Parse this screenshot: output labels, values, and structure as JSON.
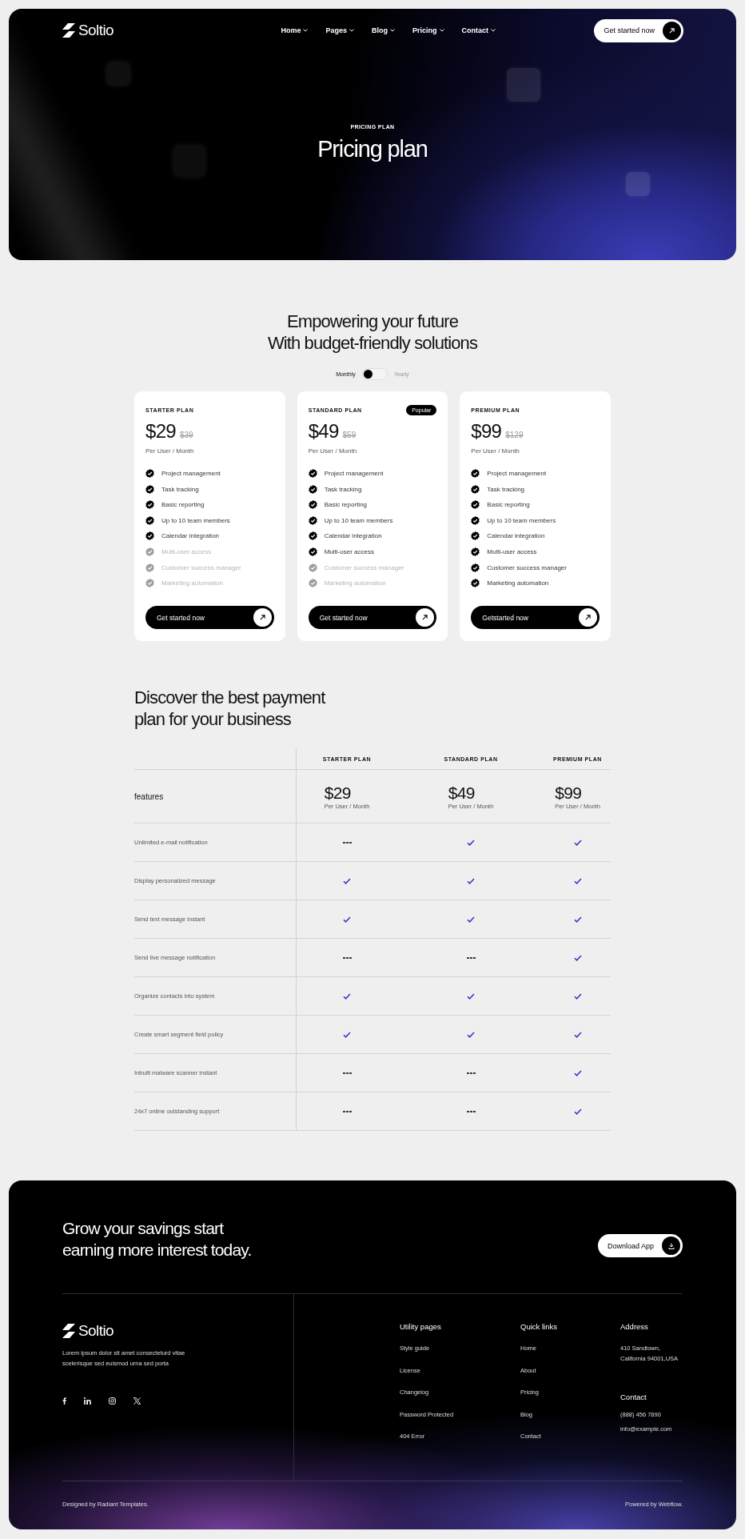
{
  "brand": "Soltio",
  "nav": [
    {
      "label": "Home"
    },
    {
      "label": "Pages"
    },
    {
      "label": "Blog"
    },
    {
      "label": "Pricing"
    },
    {
      "label": "Contact"
    }
  ],
  "nav_button": "Get started now",
  "hero": {
    "eyebrow": "PRICING PLAN",
    "title": "Pricing plan"
  },
  "pricing": {
    "heading": [
      "Empowering your future",
      "With budget-friendly solutions"
    ],
    "billing_toggle": {
      "left": "Monthly",
      "right": "Yearly",
      "yearly": false
    },
    "plans": [
      {
        "name": "STARTER PLAN",
        "price": "$29",
        "old_price": "$39",
        "period": "Per User / Month",
        "button": "Get started now",
        "features": [
          {
            "label": "Project management",
            "included": true
          },
          {
            "label": "Task tracking",
            "included": true
          },
          {
            "label": "Basic reporting",
            "included": true
          },
          {
            "label": "Up to 10 team members",
            "included": true
          },
          {
            "label": "Calendar integration",
            "included": true
          },
          {
            "label": "Multi-user access",
            "included": false
          },
          {
            "label": "Customer success manager",
            "included": false
          },
          {
            "label": "Marketing automation",
            "included": false
          }
        ]
      },
      {
        "name": "STANDARD PLAN",
        "price": "$49",
        "old_price": "$59",
        "period": "Per User / Month",
        "badge": "Popular",
        "button": "Get started now",
        "features": [
          {
            "label": "Project management",
            "included": true
          },
          {
            "label": "Task tracking",
            "included": true
          },
          {
            "label": "Basic reporting",
            "included": true
          },
          {
            "label": "Up to 10 team members",
            "included": true
          },
          {
            "label": "Calendar integration",
            "included": true
          },
          {
            "label": "Multi-user access",
            "included": true
          },
          {
            "label": "Customer success manager",
            "included": false
          },
          {
            "label": "Marketing automation",
            "included": false
          }
        ]
      },
      {
        "name": "PREMIUM PLAN",
        "price": "$99",
        "old_price": "$129",
        "period": "Per User / Month",
        "button": "Getstarted now",
        "features": [
          {
            "label": "Project management",
            "included": true
          },
          {
            "label": "Task tracking",
            "included": true
          },
          {
            "label": "Basic reporting",
            "included": true
          },
          {
            "label": "Up to 10 team members",
            "included": true
          },
          {
            "label": "Calendar integration",
            "included": true
          },
          {
            "label": "Multi-user access",
            "included": true
          },
          {
            "label": "Customer success manager",
            "included": true
          },
          {
            "label": "Marketing automation",
            "included": true
          }
        ]
      }
    ]
  },
  "comparison": {
    "heading": [
      "Discover the best payment",
      "plan for your business"
    ],
    "features_label": "features",
    "columns": [
      {
        "name": "STARTER PLAN",
        "price": "$29",
        "period": "Per User / Month"
      },
      {
        "name": "STANDARD PLAN",
        "price": "$49",
        "period": "Per User / Month"
      },
      {
        "name": "PREMIUM PLAN",
        "price": "$99",
        "period": "Per User / Month"
      }
    ],
    "rows": [
      {
        "label": "Unlimited e-mail notification",
        "included": [
          false,
          true,
          true
        ]
      },
      {
        "label": "Display personalized message",
        "included": [
          true,
          true,
          true
        ]
      },
      {
        "label": "Send text message instant",
        "included": [
          true,
          true,
          true
        ]
      },
      {
        "label": "Send live message notification",
        "included": [
          false,
          false,
          true
        ]
      },
      {
        "label": "Organize contacts into system",
        "included": [
          true,
          true,
          true
        ]
      },
      {
        "label": "Create smart segment field policy",
        "included": [
          true,
          true,
          true
        ]
      },
      {
        "label": "Inbuilt malware scanner instant",
        "included": [
          false,
          false,
          true
        ]
      },
      {
        "label": "24x7 online outstanding support",
        "included": [
          false,
          false,
          true
        ]
      }
    ]
  },
  "footer": {
    "cta": [
      "Grow your savings start",
      "earning more interest today."
    ],
    "cta_button": "Download App",
    "brand": "Soltio",
    "about": "Lorem ipsum dolor sit amet consecteturd vitae scelerisque sed euismod urna sed porta",
    "socials": [
      {
        "kind": "facebook"
      },
      {
        "kind": "linkedin"
      },
      {
        "kind": "instagram"
      },
      {
        "kind": "x"
      }
    ],
    "columns": [
      {
        "title": "Utility pages",
        "links": [
          "Style guide",
          "License",
          "Changelog",
          "Password Protected",
          "404 Error"
        ]
      },
      {
        "title": "Quick links",
        "links": [
          "Home",
          "About",
          "Pricing",
          "Blog",
          "Contact"
        ]
      }
    ],
    "address": {
      "title": "Address",
      "lines": [
        "410 Sandtown,",
        "California 94001,USA"
      ]
    },
    "contact": {
      "title": "Contact",
      "lines": [
        "(888) 456 7890",
        "info@example.com"
      ]
    },
    "credit_left": "Designed by Radiant Templates.",
    "credit_right": "Powered by Webflow."
  }
}
